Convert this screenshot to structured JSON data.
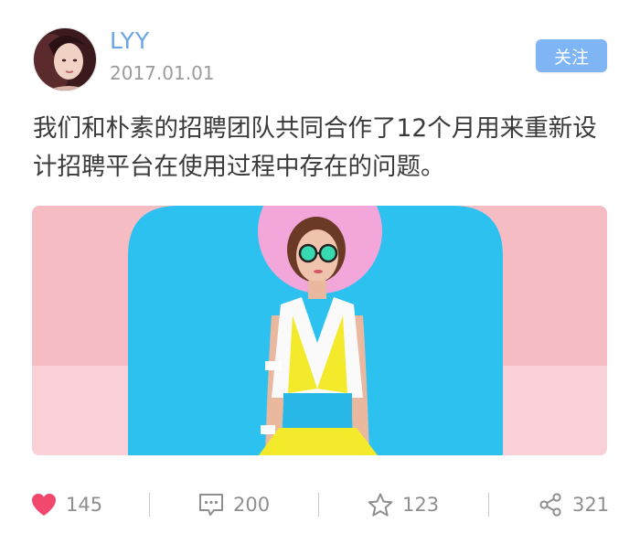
{
  "post": {
    "author": {
      "name": "LYY",
      "avatar_icon": "user-avatar-photo"
    },
    "timestamp": "2017.01.01",
    "follow_label": "关注",
    "text": "我们和朴素的招聘团队共同合作了12个月用来重新设计招聘平台在使用过程中存在的问题。",
    "image": {
      "subject": "fashion-illustration",
      "colors": {
        "sky_blue": "#2cc1ef",
        "pink": "#f5bcc3",
        "sun_pink": "#f2a6d9",
        "dress_yellow": "#f4ea2c"
      }
    }
  },
  "actions": {
    "like": {
      "icon": "heart-icon",
      "count": "145",
      "color": "#f2486e"
    },
    "comment": {
      "icon": "comment-icon",
      "count": "200"
    },
    "favorite": {
      "icon": "star-icon",
      "count": "123"
    },
    "share": {
      "icon": "share-icon",
      "count": "321"
    }
  }
}
